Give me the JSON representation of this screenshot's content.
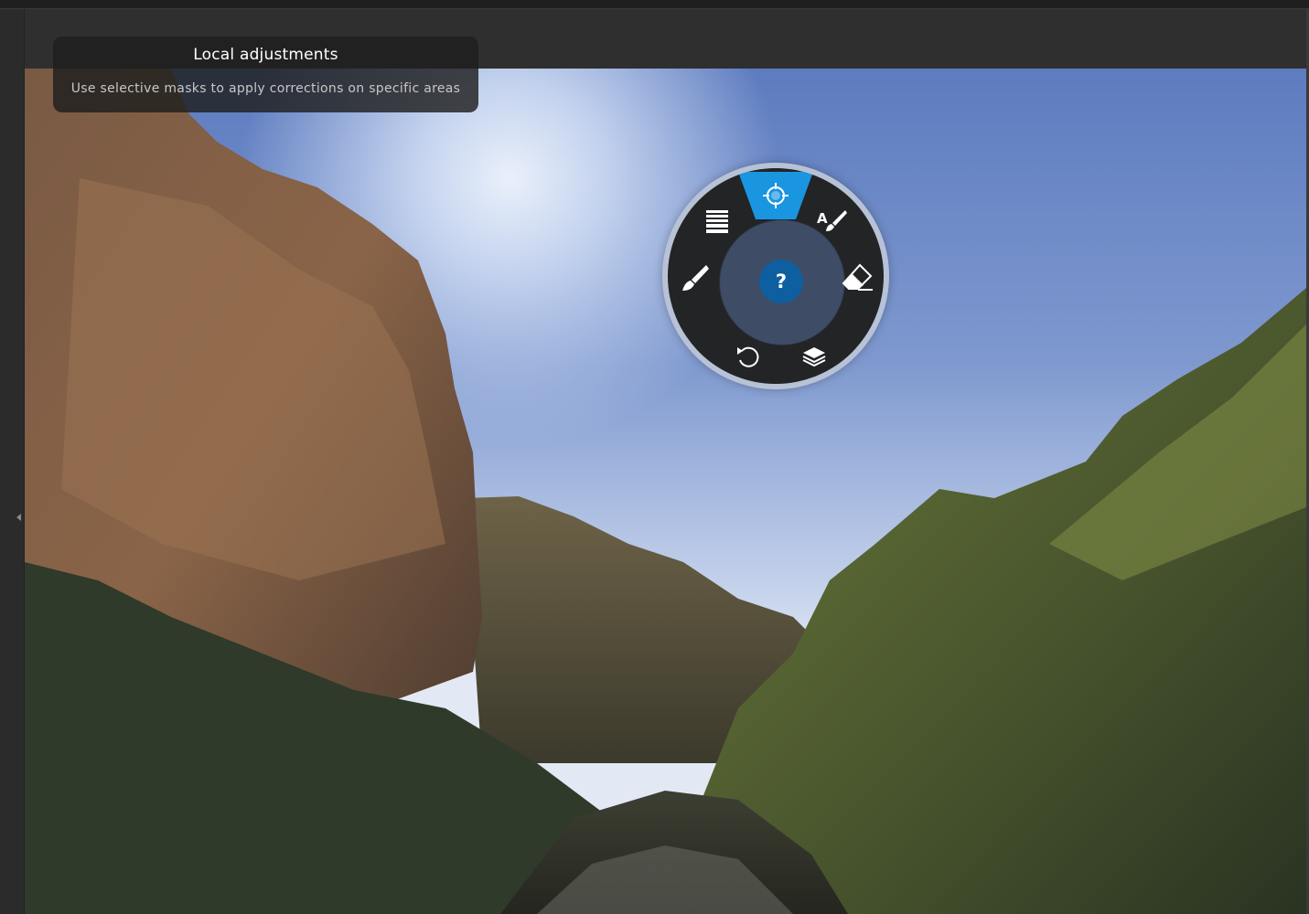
{
  "tooltip": {
    "title": "Local adjustments",
    "subtitle": "Use selective masks to apply corrections on specific areas"
  },
  "radial_menu": {
    "selected_tool": "control-point-icon",
    "center_label": "?",
    "accent_color": "#1a95e0",
    "tools": [
      {
        "icon": "control-point-icon"
      },
      {
        "icon": "auto-brush-icon",
        "label": "A"
      },
      {
        "icon": "eraser-icon"
      },
      {
        "icon": "layers-icon"
      },
      {
        "icon": "reset-icon"
      },
      {
        "icon": "brush-icon"
      },
      {
        "icon": "graduated-filter-icon"
      }
    ]
  },
  "colors": {
    "background": "#2f2f2f",
    "ring": "#232426",
    "hub": "#3e4c66",
    "help": "#0d5fa0"
  }
}
